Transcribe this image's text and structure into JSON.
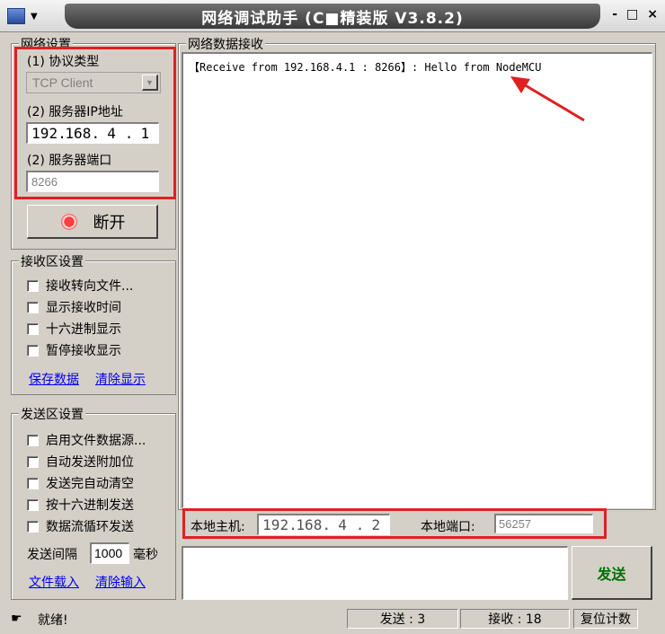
{
  "window": {
    "title": "网络调试助手 (C■精装版 V3.8.2)",
    "minimize": "-",
    "maximize": "□",
    "close": "×"
  },
  "network_settings": {
    "title": "网络设置",
    "protocol_label": "(1) 协议类型",
    "protocol_value": "TCP Client",
    "server_ip_label": "(2) 服务器IP地址",
    "server_ip": [
      "192",
      "168",
      "4",
      "1"
    ],
    "server_port_label": "(2) 服务器端口",
    "server_port": "8266",
    "connect_button": "断开"
  },
  "receive_settings": {
    "title": "接收区设置",
    "options": [
      "接收转向文件...",
      "显示接收时间",
      "十六进制显示",
      "暂停接收显示"
    ],
    "save_data": "保存数据",
    "clear_display": "清除显示"
  },
  "send_settings": {
    "title": "发送区设置",
    "options": [
      "启用文件数据源...",
      "自动发送附加位",
      "发送完自动清空",
      "按十六进制发送",
      "数据流循环发送"
    ],
    "interval_label": "发送间隔",
    "interval_value": "1000",
    "interval_unit": "毫秒",
    "load_file": "文件载入",
    "clear_input": "清除输入"
  },
  "receive_panel": {
    "title": "网络数据接收",
    "content": "【Receive from 192.168.4.1 : 8266】: Hello from NodeMCU"
  },
  "local": {
    "host_label": "本地主机:",
    "host_ip": [
      "192",
      "168",
      "4",
      "2"
    ],
    "port_label": "本地端口:",
    "port_value": "56257"
  },
  "send_button": "发送",
  "status": {
    "ready": "就绪!",
    "sent": "发送 : 3",
    "received": "接收 : 18",
    "reset": "复位计数"
  },
  "colors": {
    "highlight_red": "#e02020",
    "send_green": "#007000",
    "link_blue": "#0000ee"
  }
}
